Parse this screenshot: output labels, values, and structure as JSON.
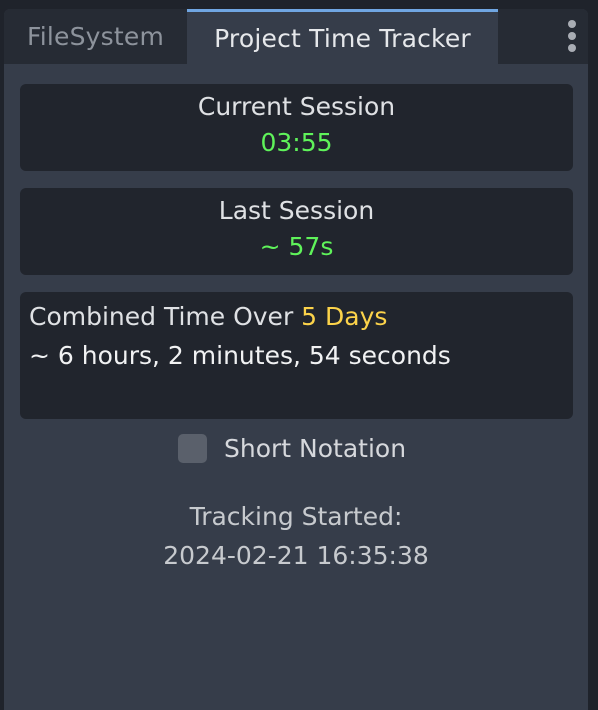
{
  "tabs": [
    {
      "label": "FileSystem",
      "active": false
    },
    {
      "label": "Project Time Tracker",
      "active": true
    }
  ],
  "current_session": {
    "label": "Current Session",
    "value": "03:55"
  },
  "last_session": {
    "label": "Last Session",
    "value": "~ 57s"
  },
  "combined": {
    "prefix": "Combined Time Over ",
    "days": "5 Days",
    "duration": "~ 6 hours, 2 minutes, 54 seconds"
  },
  "short_notation": {
    "label": "Short Notation",
    "checked": false
  },
  "tracking": {
    "label": "Tracking Started:",
    "date": "2024-02-21 16:35:38"
  },
  "colors": {
    "accent": "#70a6e2",
    "session_value": "#5ff35a",
    "days_highlight": "#fcd34a",
    "panel_bg": "#21252d",
    "dock_bg": "#363d4a"
  },
  "icons": {
    "menu": "kebab-menu-icon"
  }
}
